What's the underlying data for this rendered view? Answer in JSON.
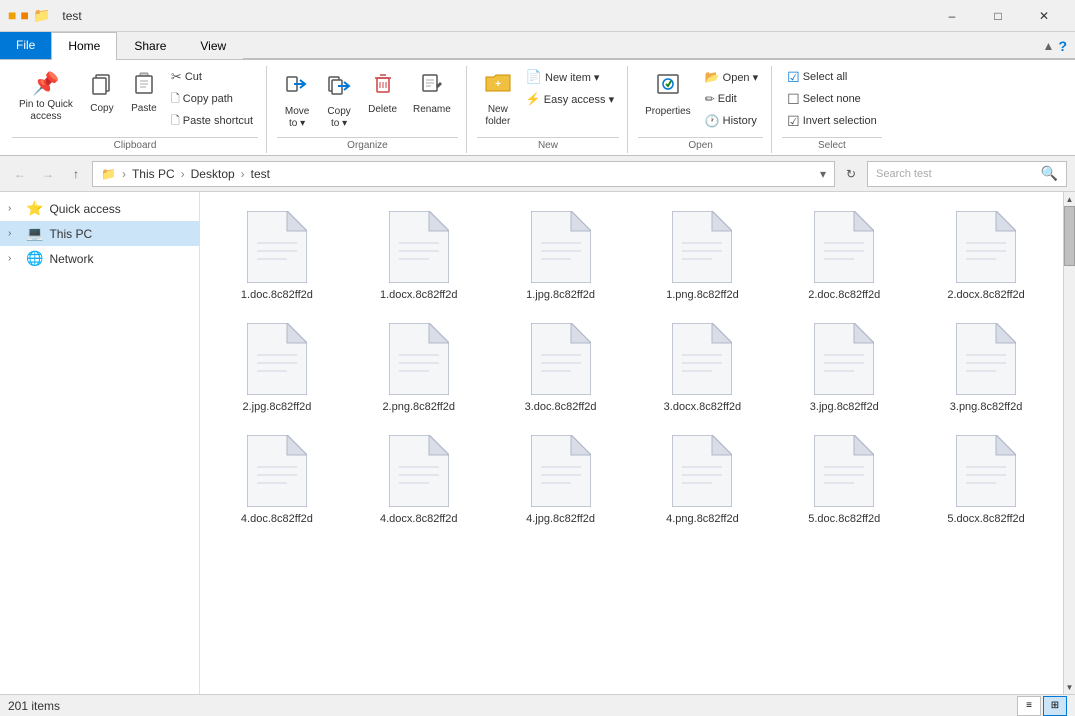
{
  "window": {
    "title": "test",
    "title_bar_icons": [
      "yellow-square-icon",
      "orange-square-icon",
      "folder-icon"
    ],
    "controls": [
      "minimize",
      "maximize",
      "close"
    ]
  },
  "tabs": [
    {
      "label": "File",
      "id": "file",
      "active": false,
      "is_file": true
    },
    {
      "label": "Home",
      "id": "home",
      "active": true
    },
    {
      "label": "Share",
      "id": "share",
      "active": false
    },
    {
      "label": "View",
      "id": "view",
      "active": false
    }
  ],
  "ribbon": {
    "groups": [
      {
        "id": "clipboard",
        "label": "Clipboard",
        "items": [
          {
            "type": "large",
            "icon": "📌",
            "label": "Pin to Quick\naccess",
            "id": "pin-quick-access"
          },
          {
            "type": "large",
            "icon": "📋",
            "label": "Copy",
            "id": "copy"
          },
          {
            "type": "large",
            "icon": "📄",
            "label": "Paste",
            "id": "paste"
          },
          {
            "type": "small-group",
            "items": [
              {
                "icon": "✂",
                "label": "Cut",
                "id": "cut"
              },
              {
                "icon": "🗋",
                "label": "Copy path",
                "id": "copy-path"
              },
              {
                "icon": "🗋",
                "label": "Paste shortcut",
                "id": "paste-shortcut"
              }
            ]
          }
        ]
      },
      {
        "id": "organize",
        "label": "Organize",
        "items": [
          {
            "type": "large-split",
            "icon": "➡",
            "label": "Move\nto ▾",
            "id": "move-to"
          },
          {
            "type": "large-split",
            "icon": "🗋",
            "label": "Copy\nto ▾",
            "id": "copy-to"
          },
          {
            "type": "large",
            "icon": "🗑",
            "label": "Delete",
            "id": "delete"
          },
          {
            "type": "large",
            "icon": "✏",
            "label": "Rename",
            "id": "rename"
          }
        ]
      },
      {
        "id": "new",
        "label": "New",
        "items": [
          {
            "type": "large",
            "icon": "📁",
            "label": "New\nfolder",
            "id": "new-folder"
          },
          {
            "type": "large-split",
            "icon": "📄",
            "label": "New item ▾",
            "id": "new-item"
          },
          {
            "type": "small",
            "icon": "⚡",
            "label": "Easy access ▾",
            "id": "easy-access"
          }
        ]
      },
      {
        "id": "open",
        "label": "Open",
        "items": [
          {
            "type": "large",
            "icon": "✔",
            "label": "Properties",
            "id": "properties"
          },
          {
            "type": "small-group",
            "items": [
              {
                "icon": "📂",
                "label": "Open ▾",
                "id": "open-btn"
              },
              {
                "icon": "✏",
                "label": "Edit",
                "id": "edit"
              },
              {
                "icon": "🕐",
                "label": "History",
                "id": "history"
              }
            ]
          }
        ]
      },
      {
        "id": "select",
        "label": "Select",
        "items": [
          {
            "type": "small",
            "icon": "☑",
            "label": "Select all",
            "id": "select-all"
          },
          {
            "type": "small",
            "icon": "☐",
            "label": "Select none",
            "id": "select-none"
          },
          {
            "type": "small",
            "icon": "☑",
            "label": "Invert selection",
            "id": "invert-selection"
          }
        ]
      }
    ]
  },
  "address_bar": {
    "back_enabled": false,
    "forward_enabled": false,
    "up_enabled": true,
    "crumbs": [
      "This PC",
      "Desktop",
      "test"
    ],
    "refresh_tooltip": "Refresh",
    "search_placeholder": "Search test"
  },
  "sidebar": {
    "items": [
      {
        "id": "quick-access",
        "label": "Quick access",
        "icon": "⭐",
        "color": "#f0a000",
        "expanded": false,
        "indent": 0
      },
      {
        "id": "this-pc",
        "label": "This PC",
        "icon": "💻",
        "color": "#0078d7",
        "expanded": false,
        "indent": 0,
        "selected": true
      },
      {
        "id": "network",
        "label": "Network",
        "icon": "🌐",
        "color": "#0078d7",
        "expanded": false,
        "indent": 0
      }
    ]
  },
  "files": [
    {
      "name": "1.doc.8c82ff2d",
      "type": "doc"
    },
    {
      "name": "1.docx.8c82ff2d",
      "type": "docx"
    },
    {
      "name": "1.jpg.8c82ff2d",
      "type": "jpg"
    },
    {
      "name": "1.png.8c82ff2d",
      "type": "png"
    },
    {
      "name": "2.doc.8c82ff2d",
      "type": "doc"
    },
    {
      "name": "2.docx.8c82ff2d",
      "type": "docx"
    },
    {
      "name": "2.jpg.8c82ff2d",
      "type": "jpg"
    },
    {
      "name": "2.png.8c82ff2d",
      "type": "png"
    },
    {
      "name": "3.doc.8c82ff2d",
      "type": "doc"
    },
    {
      "name": "3.docx.8c82ff2d",
      "type": "docx"
    },
    {
      "name": "3.jpg.8c82ff2d",
      "type": "jpg"
    },
    {
      "name": "3.png.8c82ff2d",
      "type": "png"
    },
    {
      "name": "4.doc.8c82ff2d",
      "type": "doc"
    },
    {
      "name": "4.docx.8c82ff2d",
      "type": "docx"
    },
    {
      "name": "4.jpg.8c82ff2d",
      "type": "jpg"
    },
    {
      "name": "4.png.8c82ff2d",
      "type": "png"
    },
    {
      "name": "5.doc.8c82ff2d",
      "type": "doc"
    },
    {
      "name": "5.docx.8c82ff2d",
      "type": "docx"
    }
  ],
  "status": {
    "item_count": "201 items"
  },
  "view_buttons": [
    {
      "id": "list-view",
      "icon": "≡≡",
      "active": false
    },
    {
      "id": "grid-view",
      "icon": "⊞",
      "active": true
    }
  ]
}
